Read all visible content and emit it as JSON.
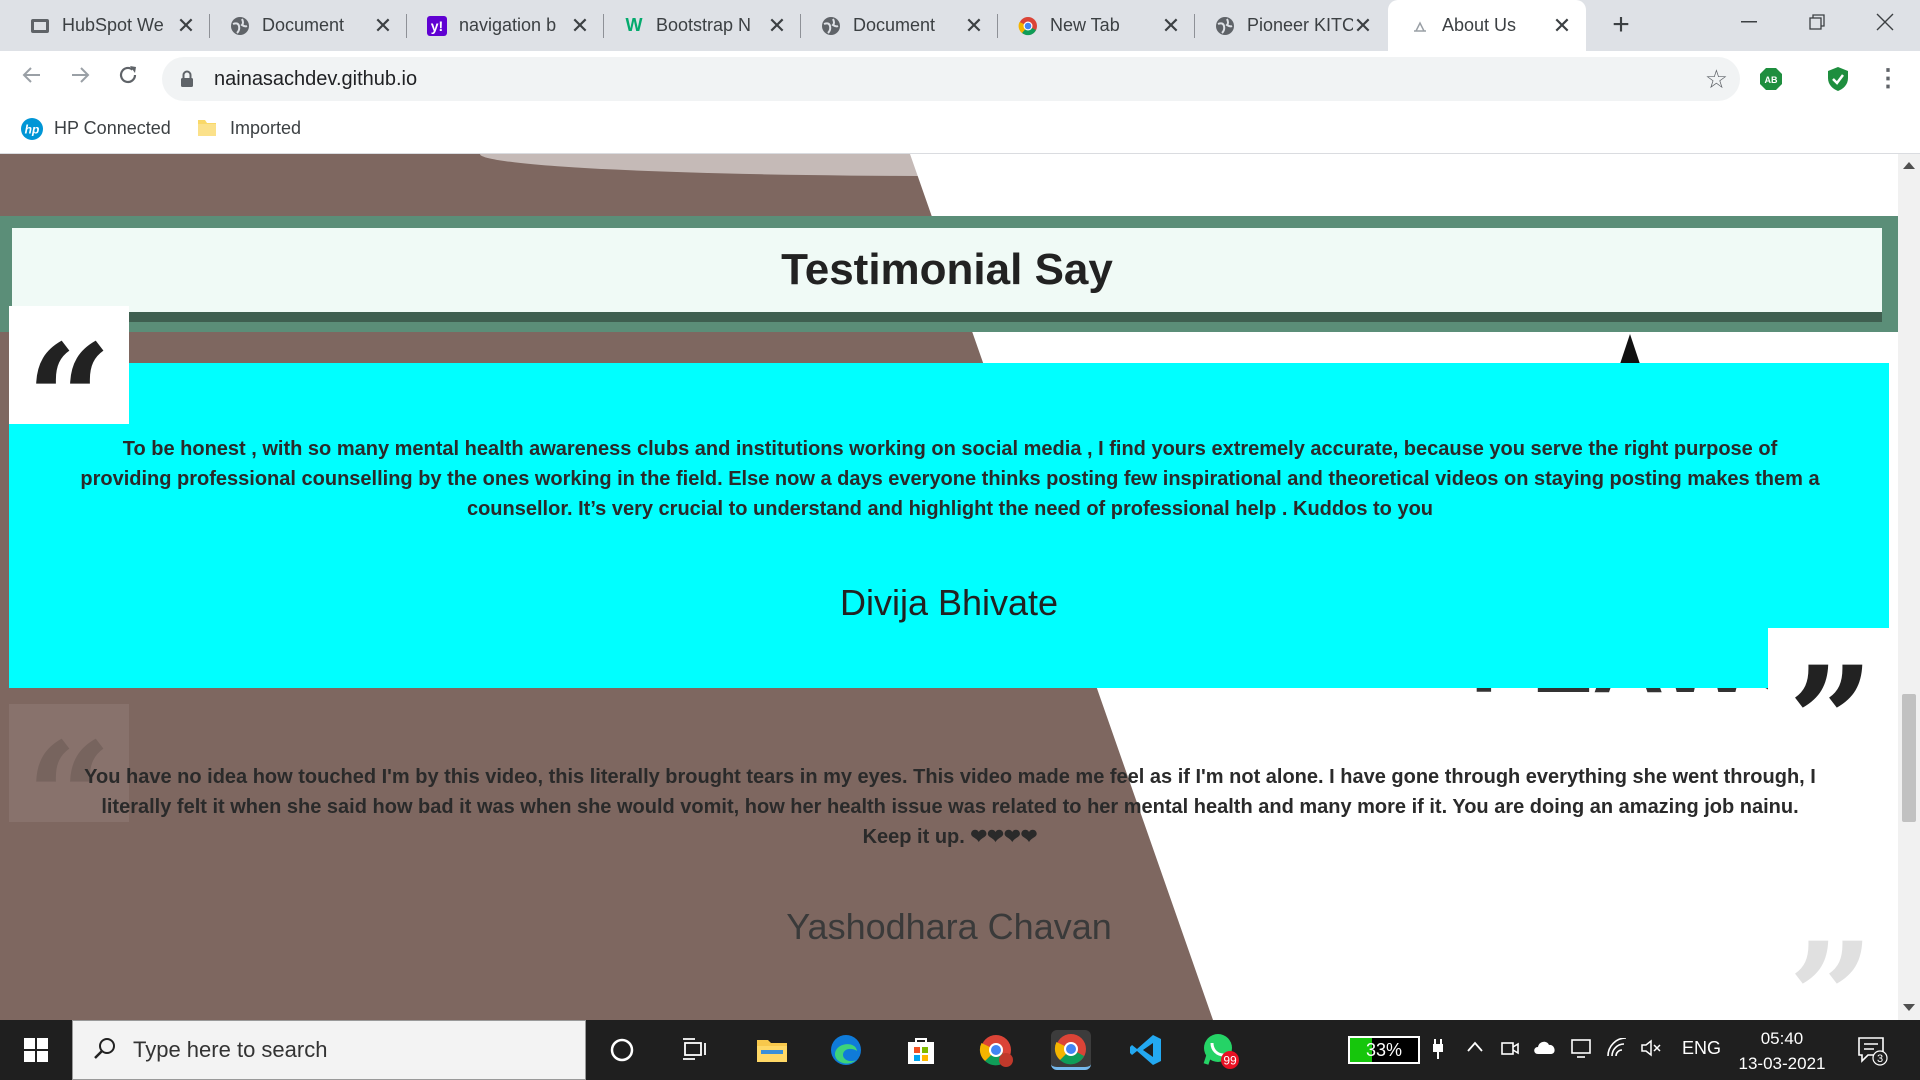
{
  "browser": {
    "tabs": [
      {
        "title": "HubSpot We",
        "favicon": "hubspot-icon"
      },
      {
        "title": "Document",
        "favicon": "globe-icon"
      },
      {
        "title": "navigation b",
        "favicon": "yahoo-icon"
      },
      {
        "title": "Bootstrap N",
        "favicon": "w3schools-icon"
      },
      {
        "title": "Document",
        "favicon": "globe-icon"
      },
      {
        "title": "New Tab",
        "favicon": "chrome-icon"
      },
      {
        "title": "Pioneer KITC",
        "favicon": "globe-icon"
      },
      {
        "title": "About Us",
        "favicon": "page-icon",
        "active": true
      }
    ],
    "url": "nainasachdev.github.io",
    "extensions": [
      {
        "name": "adblock-icon",
        "label": "AB",
        "color": "#1e8e3e"
      },
      {
        "name": "shield-check-icon",
        "label": "✓",
        "color": "#1e8e3e"
      }
    ],
    "bookmarks": [
      {
        "label": "HP Connected",
        "icon": "hp-icon"
      },
      {
        "label": "Imported",
        "icon": "folder-icon"
      }
    ]
  },
  "page": {
    "heading": "Testimonial Say",
    "testimonials": [
      {
        "text": "To be honest , with so many mental health awareness clubs and institutions working on social media , I find yours extremely accurate, because you serve the right purpose of providing professional counselling by the ones working in the field. Else now a days everyone thinks posting few inspirational and theoretical videos on staying posting makes them a counsellor. It’s very crucial to understand and highlight the need of professional help . Kuddos to you",
        "name": "Divija Bhivate"
      },
      {
        "text": "You have no idea how touched I'm by this video, this literally brought tears in my eyes. This video made me feel as if I'm not alone. I have gone through everything she went through, I literally felt it when she said how bad it was when she would vomit, how her health issue was related to her mental health and many more if it. You are doing an amazing job nainu. Keep it up. ❤❤❤❤",
        "name": "Yashodhara Chavan"
      }
    ],
    "colors": {
      "card_bg": "#00ffff",
      "heading_border": "#5b8e78",
      "bg_brown": "#7e6760"
    }
  },
  "taskbar": {
    "search_placeholder": "Type here to search",
    "battery_percent": "33%",
    "battery_level": 0.33,
    "language": "ENG",
    "time": "05:40",
    "date": "13-03-2021",
    "whatsapp_badge": "99",
    "notification_count": "3"
  }
}
